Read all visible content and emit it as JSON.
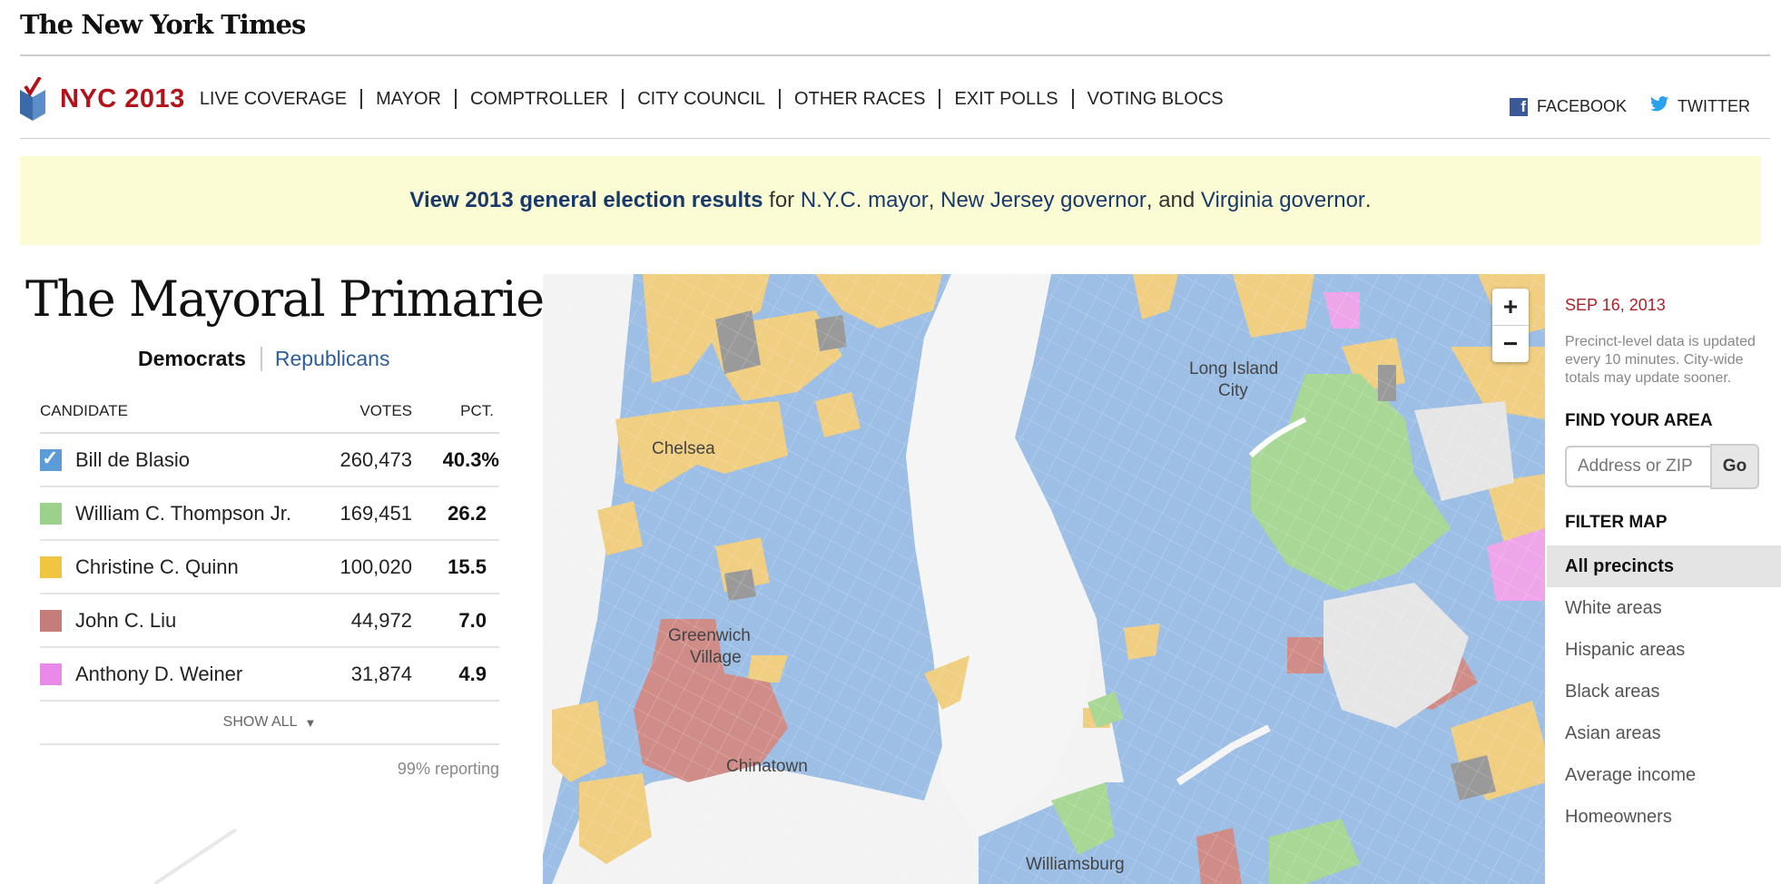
{
  "header": {
    "masthead": "The New York Times"
  },
  "nav": {
    "brand": "NYC 2013",
    "items": [
      "LIVE COVERAGE",
      "MAYOR",
      "COMPTROLLER",
      "CITY COUNCIL",
      "OTHER RACES",
      "EXIT POLLS",
      "VOTING BLOCS"
    ],
    "facebook": "FACEBOOK",
    "twitter": "TWITTER"
  },
  "banner": {
    "strong": "View 2013 general election results",
    "t1": " for ",
    "link1": "N.Y.C. mayor",
    "t2": ", ",
    "link2": "New Jersey governor",
    "t3": ", and ",
    "link3": "Virginia governor",
    "t4": "."
  },
  "page": {
    "title": "The Mayoral Primaries"
  },
  "tabs": {
    "dem": "Democrats",
    "rep": "Republicans"
  },
  "table": {
    "headers": {
      "candidate": "CANDIDATE",
      "votes": "VOTES",
      "pct": "PCT."
    },
    "rows": [
      {
        "name": "Bill de Blasio",
        "votes": "260,473",
        "pct": "40.3%",
        "color": "#5b9bd8"
      },
      {
        "name": "William C. Thompson Jr.",
        "votes": "169,451",
        "pct": "26.2",
        "color": "#9bd18a"
      },
      {
        "name": "Christine C. Quinn",
        "votes": "100,020",
        "pct": "15.5",
        "color": "#f1c542"
      },
      {
        "name": "John C. Liu",
        "votes": "44,972",
        "pct": "7.0",
        "color": "#c47d78"
      },
      {
        "name": "Anthony D. Weiner",
        "votes": "31,874",
        "pct": "4.9",
        "color": "#e98ae8"
      }
    ],
    "show_all": "SHOW ALL",
    "reporting": "99% reporting"
  },
  "map": {
    "labels": [
      "Chelsea",
      "Greenwich",
      "Village",
      "Chinatown",
      "Long Island",
      "City",
      "Williamsburg"
    ],
    "colors": {
      "blue": "#9dbfe6",
      "yellow": "#f0ce82",
      "green": "#a9d796",
      "red": "#d08d88",
      "pink": "#eea5ea",
      "gray": "#9a9a9a"
    }
  },
  "sidebar": {
    "date": "SEP 16, 2013",
    "note": "Precinct-level data is updated every 10 minutes. City-wide totals may update sooner.",
    "find_title": "FIND YOUR AREA",
    "search_placeholder": "Address or ZIP",
    "go": "Go",
    "filter_title": "FILTER MAP",
    "filters": [
      "All precincts",
      "White areas",
      "Hispanic areas",
      "Black areas",
      "Asian areas",
      "Average income",
      "Homeowners"
    ]
  }
}
